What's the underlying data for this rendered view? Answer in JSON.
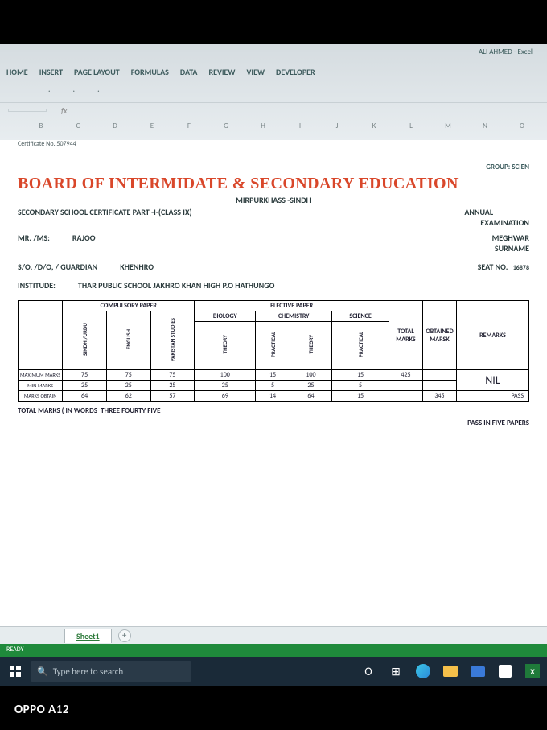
{
  "titlebar": {
    "account": "ALI AHMED - Excel"
  },
  "ribbon": [
    "HOME",
    "INSERT",
    "PAGE LAYOUT",
    "FORMULAS",
    "DATA",
    "REVIEW",
    "VIEW",
    "DEVELOPER"
  ],
  "fx": {
    "name": "",
    "fx": "fx"
  },
  "columns": [
    "B",
    "C",
    "D",
    "E",
    "F",
    "G",
    "H",
    "I",
    "J",
    "K",
    "L",
    "M",
    "N",
    "O"
  ],
  "doc": {
    "cert_label": "Certificate No. 507944",
    "group": "GROUP: SCIEN",
    "board": "BOARD OF INTERMIDATE & SECONDARY EDUCATION",
    "location": "MIRPURKHASS -SINDH",
    "exam_type": "ANNUAL",
    "part": "SECONDARY SCHOOL CERTIFICATE PART -I-(CLASS IX)",
    "examination": "EXAMINATION",
    "mrms_label": "MR. /MS:",
    "name": "RAJOO",
    "surname_label": "SURNAME",
    "surname": "MEGHWAR",
    "guardian_label": "S/O, /D/O, / GUARDIAN",
    "guardian": "KHENHRO",
    "seat_label": "SEAT NO.",
    "seat": "16878",
    "institute_label": "INSTITUDE:",
    "institute": "THAR PUBLIC SCHOOL JAKHRO KHAN HIGH P.O HATHUNGO",
    "headers": {
      "compulsory": "COMPULSORY PAPER",
      "elective": "ELECTIVE PAPER",
      "biology": "BIOLOGY",
      "chemistry": "CHEMISTRY",
      "science": "SCIENCE",
      "total": "TOTAL MARKS",
      "obtained": "OBTAINED MARSK",
      "remarks": "REMARKS",
      "sindhi": "SINDHI/URDU",
      "english": "ENGLISH",
      "pakstudies": "PAKISTAN STUDIES",
      "theory": "THEORY",
      "practical": "PRACTICAL"
    },
    "rows": {
      "max_label": "MAXIMUM MARKS",
      "min_label": "MIN MARKS",
      "obt_label": "MARKS OBTAIN",
      "max": [
        "75",
        "75",
        "75",
        "100",
        "15",
        "100",
        "15",
        "425",
        ""
      ],
      "min": [
        "25",
        "25",
        "25",
        "25",
        "5",
        "25",
        "5",
        "",
        ""
      ],
      "obt": [
        "64",
        "62",
        "57",
        "69",
        "14",
        "64",
        "15",
        "",
        "345"
      ]
    },
    "nil": "NIL",
    "pass": "PASS",
    "total_words_label": "TOTAL MARKS ( IN WORDS",
    "total_words": "THREE  FOURTY FIVE",
    "pass_papers": "PASS IN FIVE PAPERS"
  },
  "sheet_tab": "Sheet1",
  "statusbar": "READY",
  "search_placeholder": "Type here to search",
  "watermark": "OPPO A12"
}
